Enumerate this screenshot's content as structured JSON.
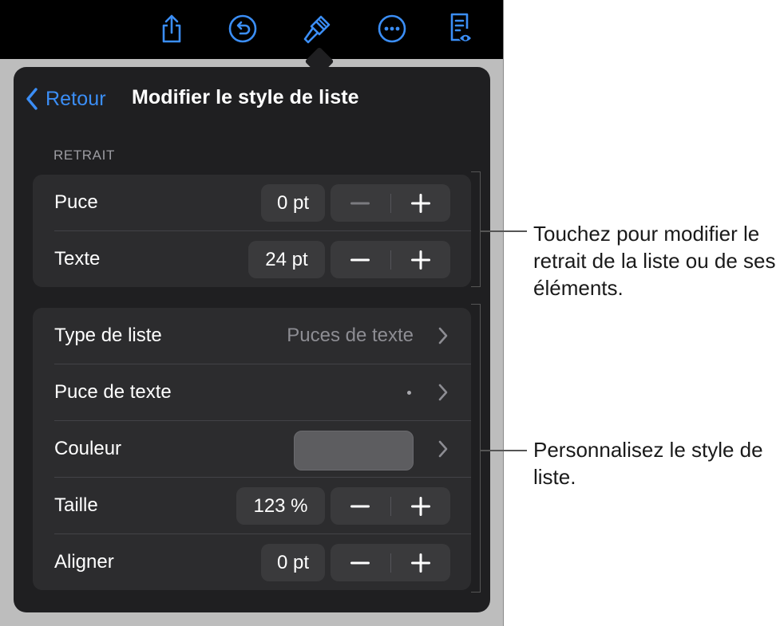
{
  "colors": {
    "accent": "#3b8ef6",
    "toolbar_background": "#000000",
    "popover_background": "#1f1f21",
    "group_background": "#2c2c2e",
    "control_background": "#3a3a3c",
    "bullet_color_swatch": "#5d5d60"
  },
  "toolbar": {
    "icons": [
      "share-icon",
      "undo-icon",
      "format-paintbrush-icon",
      "more-icon",
      "reading-view-icon"
    ]
  },
  "nav": {
    "back_label": "Retour",
    "title": "Modifier le style de liste"
  },
  "indent_section": {
    "header": "RETRAIT",
    "rows": [
      {
        "label": "Puce",
        "value": "0 pt"
      },
      {
        "label": "Texte",
        "value": "24 pt"
      }
    ]
  },
  "style_section": {
    "list_type": {
      "label": "Type de liste",
      "value": "Puces de texte"
    },
    "text_bullet": {
      "label": "Puce de texte",
      "value": "•"
    },
    "color": {
      "label": "Couleur"
    },
    "size": {
      "label": "Taille",
      "value": "123 %"
    },
    "align": {
      "label": "Aligner",
      "value": "0 pt"
    }
  },
  "callouts": {
    "indent": "Touchez pour modifier le retrait de la liste ou de ses éléments.",
    "style": "Personnalisez le style de liste."
  }
}
